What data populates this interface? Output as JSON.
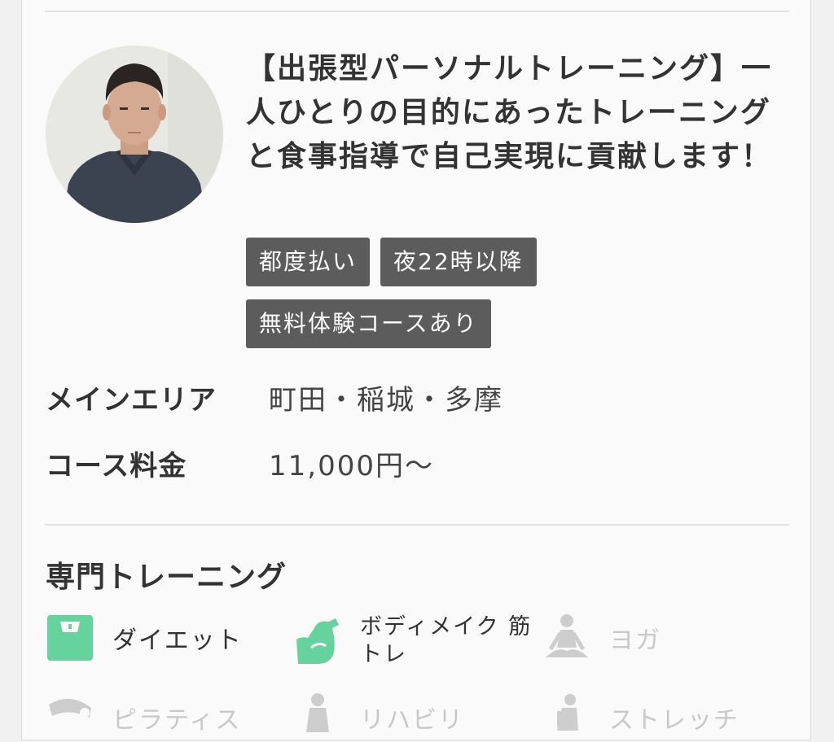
{
  "trainer": {
    "title": "【出張型パーソナルトレーニング】一人ひとりの目的にあったトレーニングと食事指導で自己実現に貢献します！",
    "tags": [
      "都度払い",
      "夜22時以降",
      "無料体験コースあり"
    ]
  },
  "info": {
    "area_label": "メインエリア",
    "area_value": "町田・稲城・多摩",
    "fee_label": "コース料金",
    "fee_value": "11,000円〜"
  },
  "specialties": {
    "heading": "専門トレーニング",
    "items": [
      {
        "label": "ダイエット",
        "icon": "scale-icon",
        "active": true
      },
      {
        "label": "ボディメイク 筋トレ",
        "icon": "muscle-arm-icon",
        "active": true
      },
      {
        "label": "ヨガ",
        "icon": "yoga-icon",
        "active": false
      },
      {
        "label": "ピラティス",
        "icon": "pilates-icon",
        "active": false
      },
      {
        "label": "リハビリ",
        "icon": "rehab-icon",
        "active": false
      },
      {
        "label": "ストレッチ",
        "icon": "stretch-icon",
        "active": false
      }
    ]
  },
  "colors": {
    "accent_green": "#66d29d",
    "inactive_gray": "#cdcdcd",
    "tag_background": "#5c5c5c"
  }
}
